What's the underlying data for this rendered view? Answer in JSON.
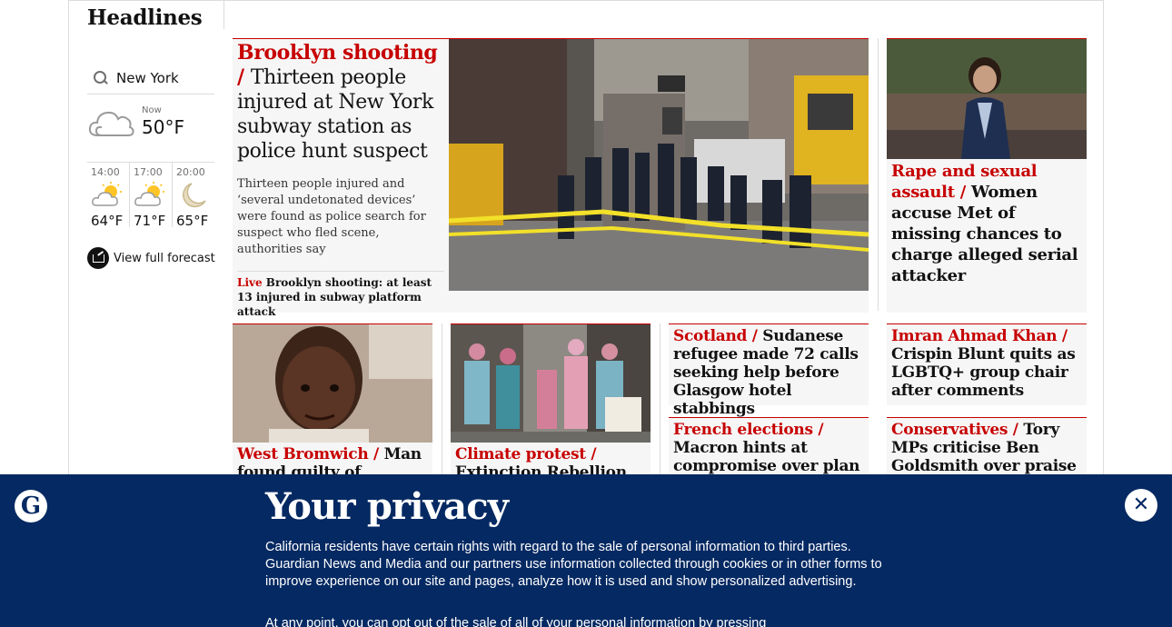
{
  "left": {
    "section_title": "Headlines",
    "location": "New York",
    "now_label": "Now",
    "now_temp": "50°F",
    "hourly": [
      {
        "time": "14:00",
        "temp": "64°F",
        "icon": "sun-cloud-icon"
      },
      {
        "time": "17:00",
        "temp": "71°F",
        "icon": "sun-cloud-icon"
      },
      {
        "time": "20:00",
        "temp": "65°F",
        "icon": "moon-icon"
      }
    ],
    "forecast_link": "View full forecast"
  },
  "lead": {
    "kicker": "Brooklyn shooting",
    "separator": " / ",
    "headline": "Thirteen people injured at New York subway station as police hunt suspect",
    "standfirst": "Thirteen people injured and ‘several undetonated devices’ were found as police search for suspect who fled scene, authorities say",
    "live_label": "Live",
    "live_text": "Brooklyn shooting: at least 13 injured in subway platform attack"
  },
  "feature": {
    "kicker": "Rape and sexual assault",
    "separator": " / ",
    "headline": "Women accuse Met of missing chances to charge alleged serial attacker"
  },
  "row2": [
    {
      "kicker": "West Bromwich",
      "separator": " / ",
      "headline": "Man found guilty of"
    },
    {
      "kicker": "Climate protest",
      "separator": " / ",
      "headline": "Extinction Rebellion"
    },
    {
      "kicker": "Scotland",
      "separator": " / ",
      "headline": "Sudanese refugee made 72 calls seeking help before Glasgow hotel stabbings"
    },
    {
      "kicker": "Imran Ahmad Khan",
      "separator": " / ",
      "headline": "Crispin Blunt quits as LGBTQ+ group chair after comments"
    },
    {
      "kicker": "French elections",
      "separator": " / ",
      "headline": "Macron hints at compromise over plan to raise retirement age"
    },
    {
      "kicker": "Conservatives",
      "separator": " / ",
      "headline": "Tory MPs criticise Ben Goldsmith over praise for Extinction"
    }
  ],
  "privacy": {
    "title": "Your privacy",
    "body": "California residents have certain rights with regard to the sale of personal information to third parties. Guardian News and Media and our partners use information collected through cookies or in other forms to improve experience on our site and pages, analyze how it is used and show personalized advertising.",
    "body2": "At any point, you can opt out of the sale of all of your personal information by pressing",
    "close_icon": "close-icon"
  },
  "colors": {
    "accent_red": "#c70000",
    "banner_blue": "#052962"
  }
}
